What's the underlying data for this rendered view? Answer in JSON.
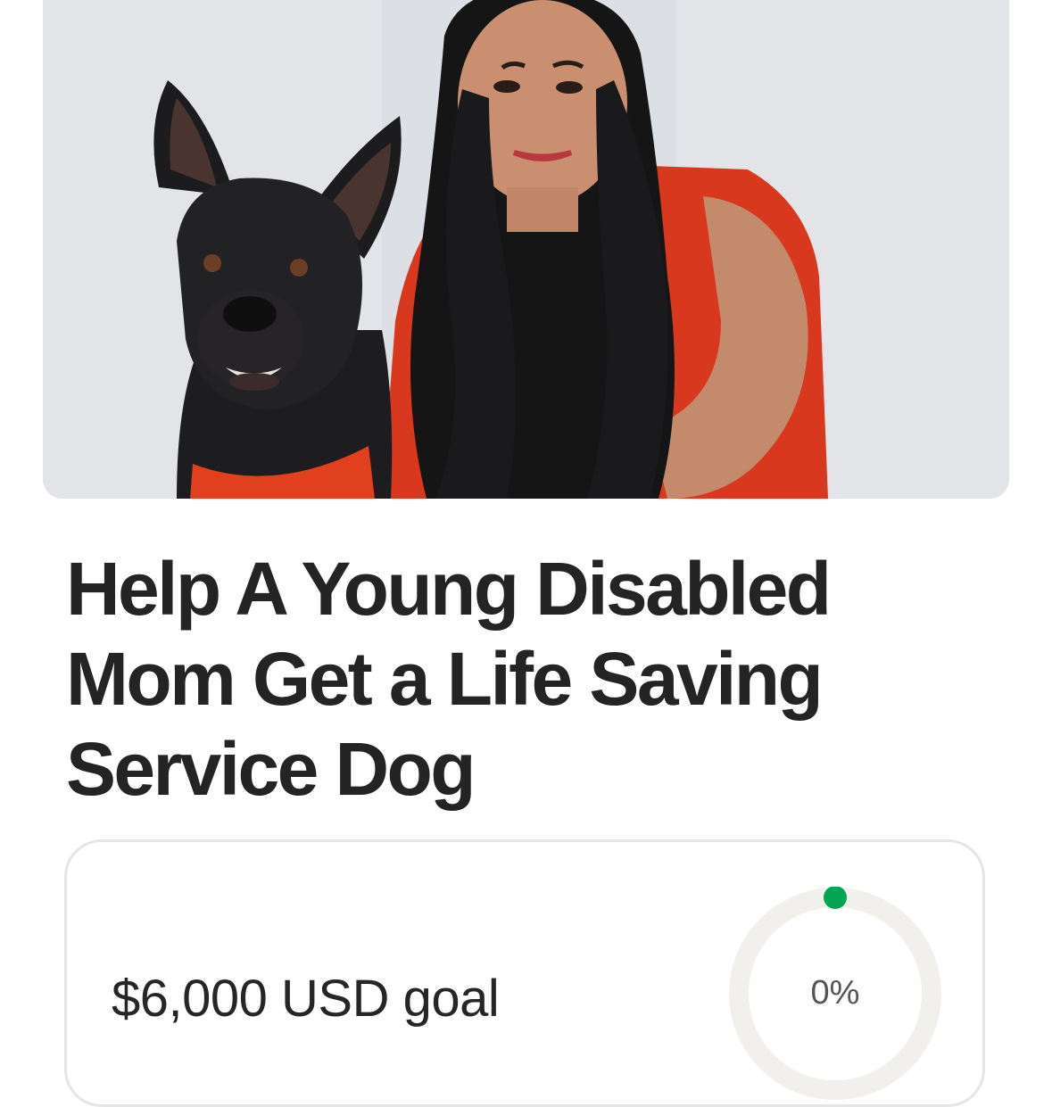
{
  "hero_image": {
    "alt_icon": "dog-and-woman-photo",
    "colors": {
      "backdrop": "#e1e3e7",
      "dog": "#1c1b1c",
      "bandana": "#e1401e",
      "dress": "#d8381e",
      "hair": "#151516",
      "skin": "#c88d6f"
    }
  },
  "campaign": {
    "title": "Help A Young Disabled Mom Get a Life Saving Service Dog"
  },
  "progress": {
    "goal_text": "$6,000 USD goal",
    "percent_label": "0%",
    "percent_value": 0,
    "colors": {
      "track": "#f1f0ed",
      "indicator": "#04a455"
    }
  }
}
